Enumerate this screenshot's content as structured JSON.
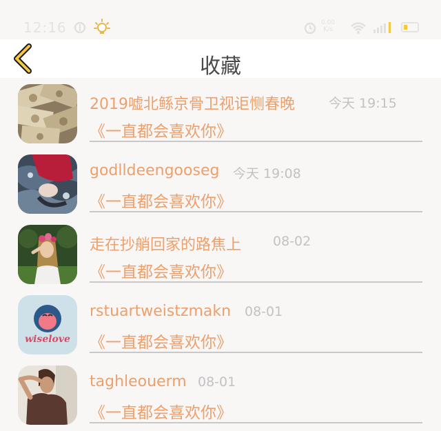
{
  "status_bar": {
    "time": "12:16",
    "net_speed_top": "0.00",
    "net_speed_bottom": "K/s",
    "icons": [
      "sync-icon",
      "bulb-icon",
      "alarm-icon",
      "wifi-icon",
      "signal-icon",
      "battery-icon"
    ],
    "battery_color": "#f5c842"
  },
  "header": {
    "back_icon": "chevron-left-icon",
    "title": "收藏",
    "accent": "#f5c842"
  },
  "items": [
    {
      "name": "2019嘘北鲧京骨卫视讵恻春晚",
      "time": "今天 19:15",
      "song": "《一直都会喜欢你》",
      "avatar": "money-photo"
    },
    {
      "name": "godlldeengooseg",
      "time": "今天 19:08",
      "song": "《一直都会喜欢你》",
      "avatar": "water-girl-photo"
    },
    {
      "name": "走在抄艄回家的路焦上",
      "time": "08-02",
      "song": "《一直都会喜欢你》",
      "avatar": "flower-girl-photo"
    },
    {
      "name": "rstuartweistzmakn",
      "time": "08-01",
      "song": "《一直都会喜欢你》",
      "avatar": "wiselove-logo"
    },
    {
      "name": "taghleouerm",
      "time": "08-01",
      "song": "《一直都会喜欢你》",
      "avatar": "man-photo"
    }
  ],
  "logo_text": "wiselove",
  "colors": {
    "name": "#eda06b",
    "time": "#c2c2c2",
    "divider": "#c8c8c8",
    "background": "#f9f6f6"
  }
}
